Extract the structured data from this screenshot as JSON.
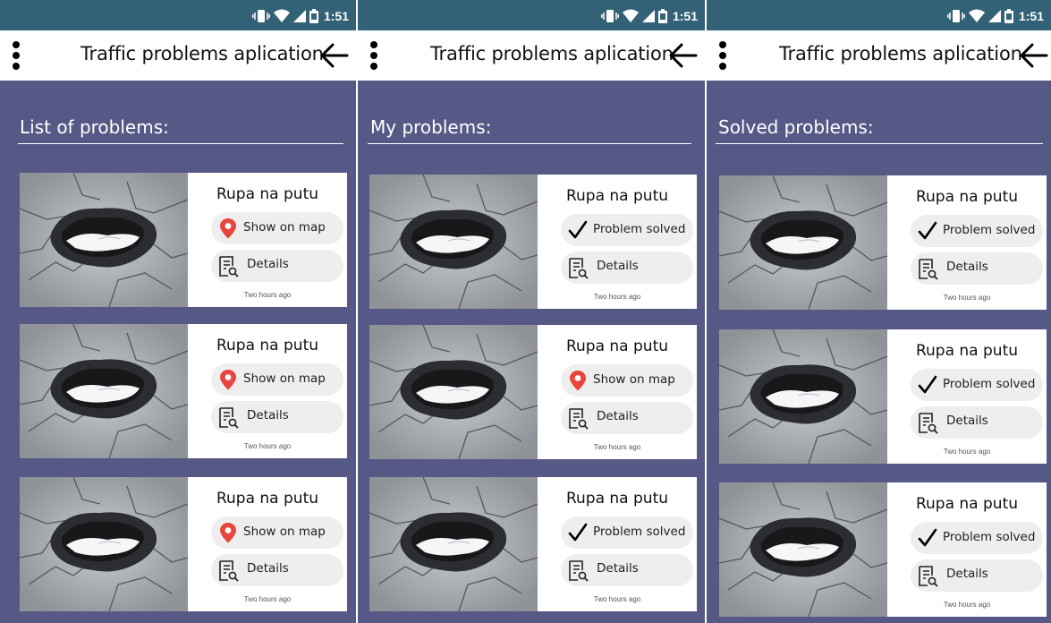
{
  "status_bar": {
    "time": "1:51"
  },
  "app_bar": {
    "title": "Traffic problems aplication"
  },
  "screens": [
    {
      "section_title": "List of problems:",
      "cards": [
        {
          "title": "Rupa na putu",
          "action": {
            "icon": "map-pin-icon",
            "label": "Show on map"
          },
          "details_label": "Details",
          "timestamp": "Two hours ago"
        },
        {
          "title": "Rupa na putu",
          "action": {
            "icon": "map-pin-icon",
            "label": "Show on map"
          },
          "details_label": "Details",
          "timestamp": "Two hours ago"
        },
        {
          "title": "Rupa na putu",
          "action": {
            "icon": "map-pin-icon",
            "label": "Show on map"
          },
          "details_label": "Details",
          "timestamp": "Two hours ago"
        }
      ]
    },
    {
      "section_title": "My problems:",
      "cards": [
        {
          "title": "Rupa na putu",
          "action": {
            "icon": "checkmark-icon",
            "label": "Problem solved"
          },
          "details_label": "Details",
          "timestamp": "Two hours ago"
        },
        {
          "title": "Rupa na putu",
          "action": {
            "icon": "map-pin-icon",
            "label": "Show on map"
          },
          "details_label": "Details",
          "timestamp": "Two hours ago"
        },
        {
          "title": "Rupa na putu",
          "action": {
            "icon": "checkmark-icon",
            "label": "Problem solved"
          },
          "details_label": "Details",
          "timestamp": "Two hours ago"
        }
      ]
    },
    {
      "section_title": "Solved problems:",
      "cards": [
        {
          "title": "Rupa na putu",
          "action": {
            "icon": "checkmark-icon",
            "label": "Problem solved"
          },
          "details_label": "Details",
          "timestamp": "Two hours ago"
        },
        {
          "title": "Rupa na putu",
          "action": {
            "icon": "checkmark-icon",
            "label": "Problem solved"
          },
          "details_label": "Details",
          "timestamp": "Two hours ago"
        },
        {
          "title": "Rupa na putu",
          "action": {
            "icon": "checkmark-icon",
            "label": "Problem solved"
          },
          "details_label": "Details",
          "timestamp": "Two hours ago"
        }
      ]
    }
  ],
  "colors": {
    "status_bar": "#336277",
    "background": "#565985",
    "card": "#ffffff",
    "pill": "#eeeeee",
    "map_pin": "#e8453c"
  }
}
